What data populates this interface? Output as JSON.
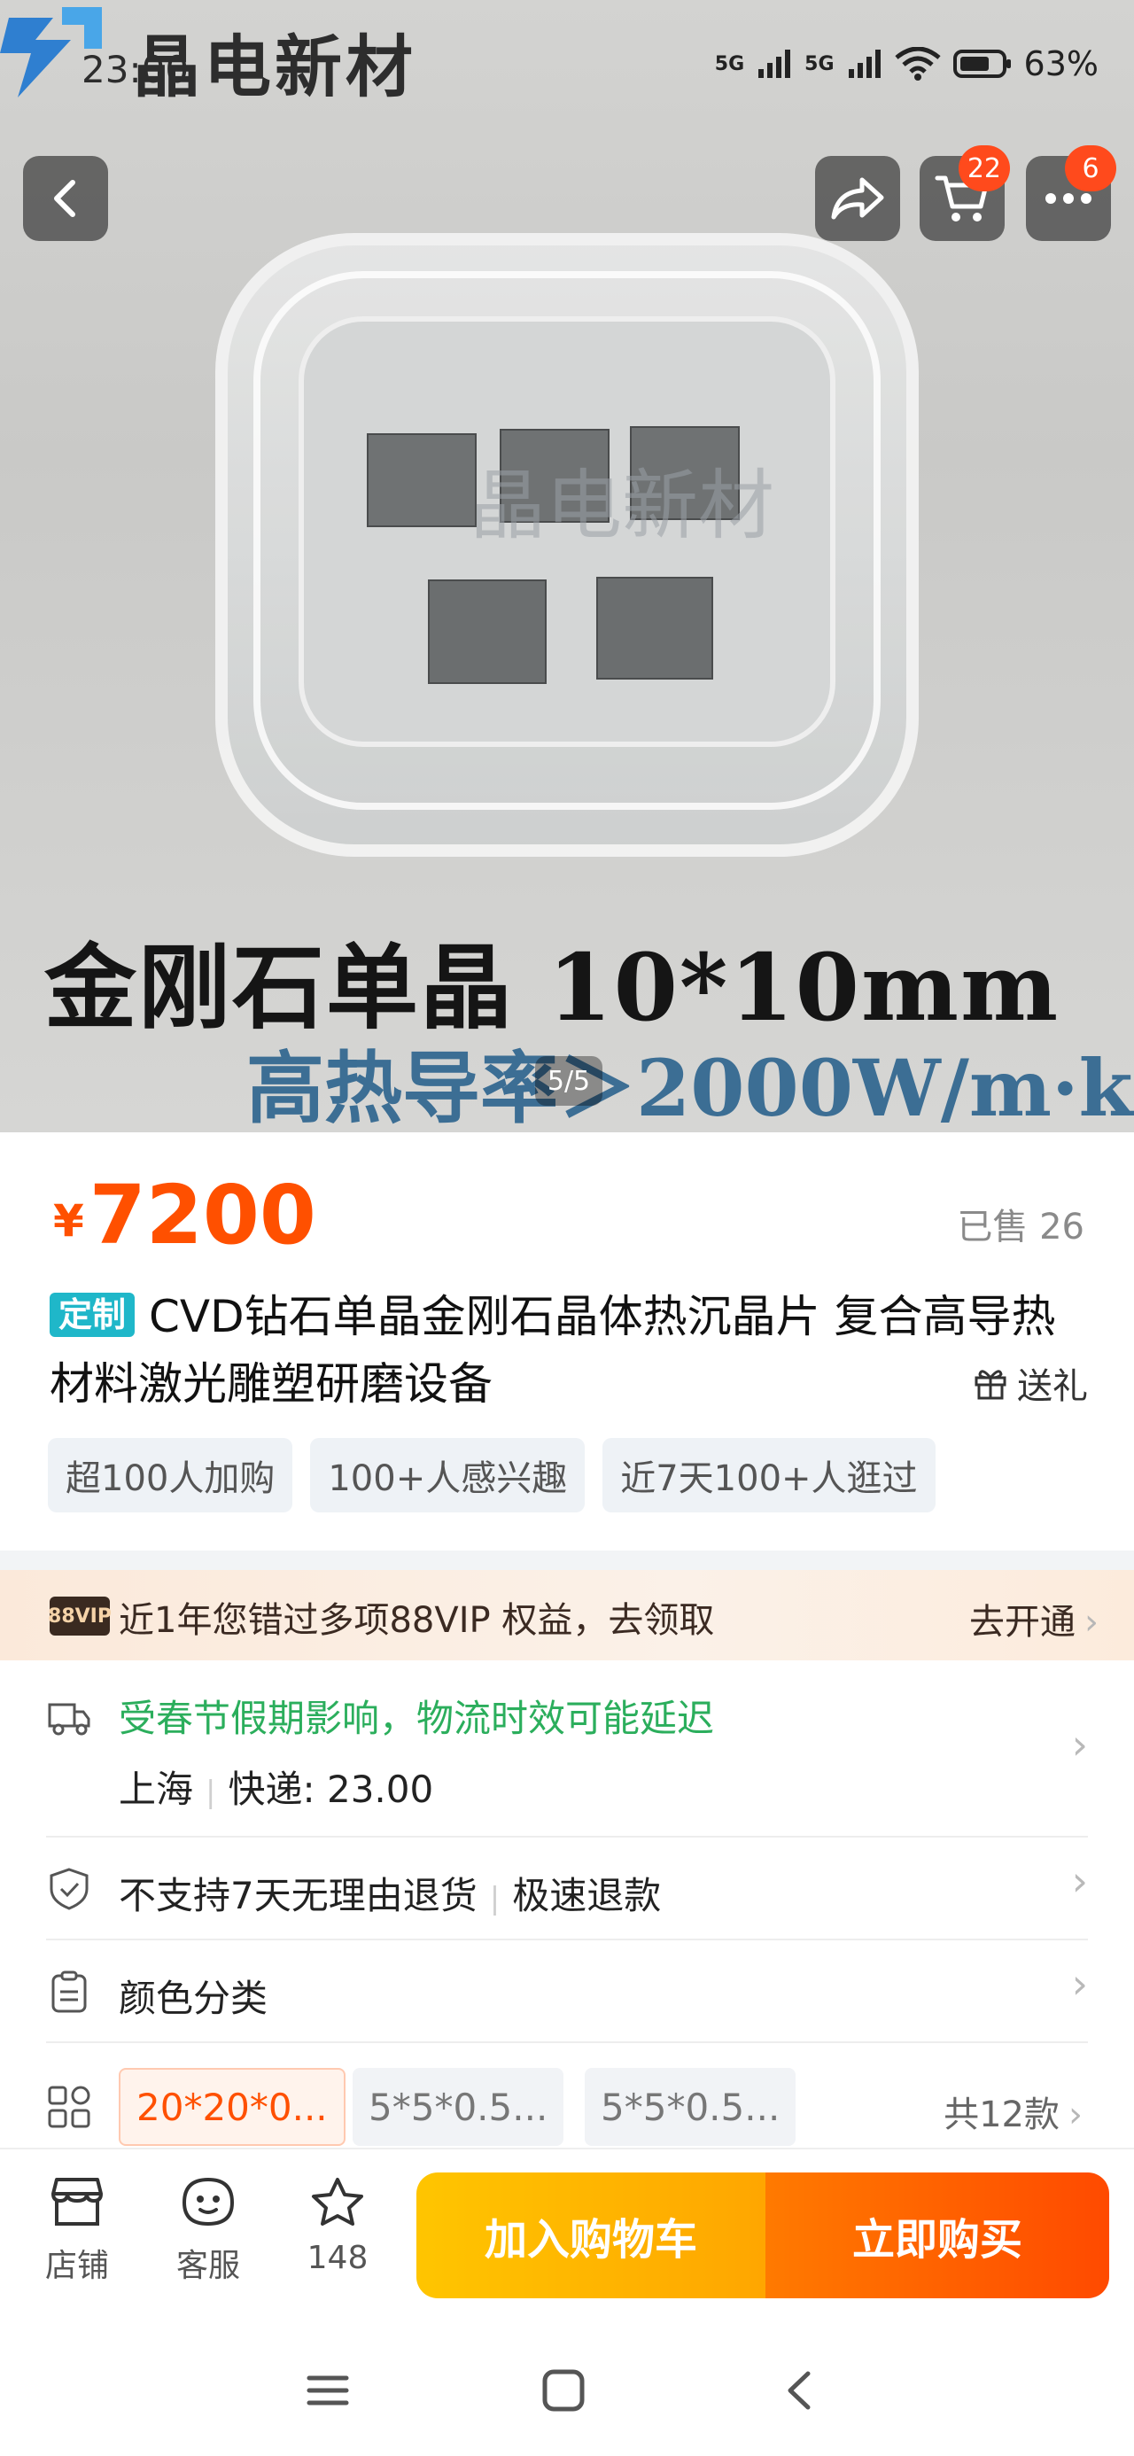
{
  "status_bar": {
    "logo_text": "晶电新材",
    "clock": "23:00",
    "network_1": "5G",
    "network_2": "5G",
    "battery": "63%"
  },
  "header": {
    "cart_badge": "22",
    "more_badge": "6"
  },
  "gallery": {
    "caption_line1": "金刚石单晶 10*10mm",
    "caption_line2": "高热导率＞2000W/m·k",
    "watermark": "晶电新材",
    "page_indicator": "5/5"
  },
  "product": {
    "currency": "¥",
    "price": "7200",
    "sold": "已售 26",
    "custom_tag": "定制",
    "title": "CVD钻石单晶金刚石晶体热沉晶片 复合高导热材料激光雕塑研磨设备",
    "gift_label": "送礼",
    "tags": [
      "超100人加购",
      "100+人感兴趣",
      "近7天100+人逛过"
    ]
  },
  "vip": {
    "badge": "88VIP",
    "text": "近1年您错过多项88VIP 权益，去领取",
    "action": "去开通"
  },
  "shipping": {
    "alert": "受春节假期影响，物流时效可能延迟",
    "origin": "上海",
    "fee": "快递: 23.00"
  },
  "returns": {
    "policy": "不支持7天无理由退货",
    "refund": "极速退款"
  },
  "variants": {
    "label": "颜色分类",
    "options": [
      "20*20*0...",
      "5*5*0.5...",
      "5*5*0.5..."
    ],
    "count": "共12款"
  },
  "bottom_bar": {
    "store": "店铺",
    "service": "客服",
    "favorites": "148",
    "add_to_cart": "加入购物车",
    "buy_now": "立即购买"
  },
  "colors": {
    "accent": "#ff5000",
    "cart_gradient_start": "#ffc500",
    "buy_gradient_end": "#ff4a00",
    "alert_green": "#2bae5c",
    "custom_tag": "#1fb7c9"
  }
}
